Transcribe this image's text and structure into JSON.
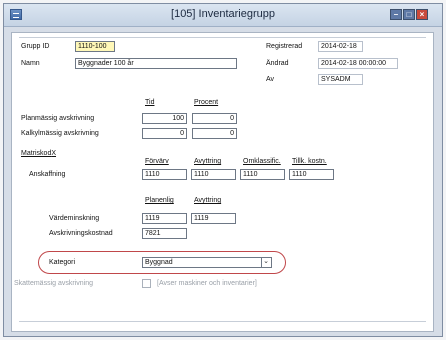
{
  "window": {
    "title": "[105] Inventariegrupp"
  },
  "header": {
    "grupp_id_label": "Grupp ID",
    "grupp_id_value": "1110-100",
    "namn_label": "Namn",
    "namn_value": "Byggnader 100 år",
    "registrerad_label": "Registrerad",
    "registrerad_value": "2014-02-18",
    "andrad_label": "Ändrad",
    "andrad_value": "2014-02-18 00:00:00",
    "av_label": "Av",
    "av_value": "SYSADM"
  },
  "avskrivning": {
    "tid_header": "Tid",
    "procent_header": "Procent",
    "rows": [
      {
        "label": "Planmässig avskrivning",
        "tid": "100",
        "procent": "0"
      },
      {
        "label": "Kalkylmässig avskrivning",
        "tid": "0",
        "procent": "0"
      }
    ]
  },
  "matriskod": {
    "title": "Matriskod",
    "title_suffix": "X",
    "columns": [
      "Förvärv",
      "Avyttring",
      "Omklassific.",
      "Tillk. kostn."
    ],
    "anskaffning_label": "Anskaffning",
    "anskaffning_values": [
      "1110",
      "1110",
      "1110",
      "1110"
    ],
    "columns2": [
      "Planenlig",
      "Avyttring"
    ],
    "vardeminskning_label": "Värdeminskning",
    "vardeminskning_values": [
      "1119",
      "1119"
    ],
    "avskrivningskostnad_label": "Avskrivningskostnad",
    "avskrivningskostnad_value": "7821"
  },
  "kategori": {
    "label": "Kategori",
    "value": "Byggnad"
  },
  "skatt": {
    "label": "Skattemässig avskrivning",
    "checkbox_text": "[Avser maskiner och inventarier]"
  },
  "colors": {
    "highlight": "#c0474a",
    "id_field_bg": "#fff8b8"
  }
}
